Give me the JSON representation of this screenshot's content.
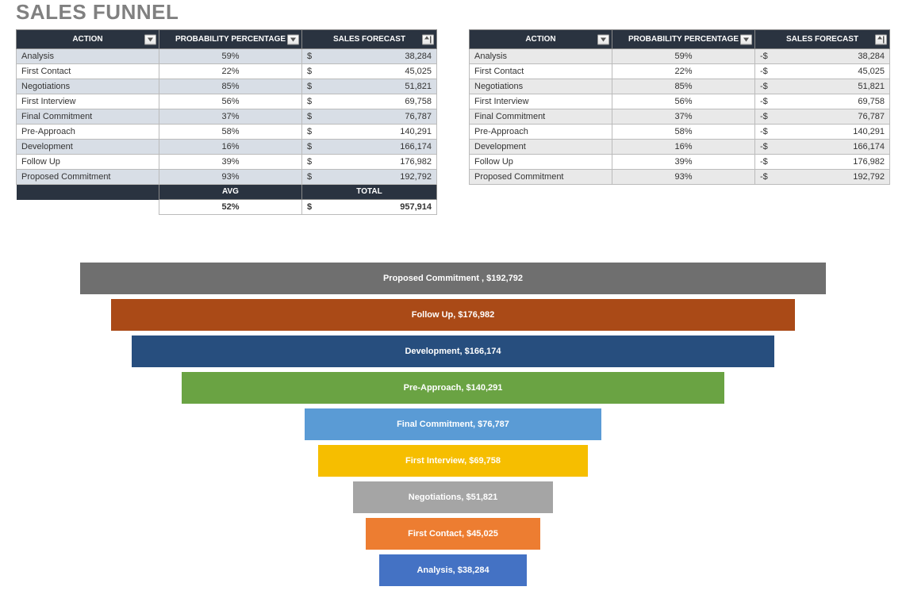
{
  "title": "SALES FUNNEL",
  "headers": {
    "action": "ACTION",
    "prob": "PROBABILITY PERCENTAGE",
    "forecast": "SALES FORECAST",
    "avg": "AVG",
    "total": "TOTAL"
  },
  "currency_left": "$",
  "currency_right": "-$",
  "rows": [
    {
      "action": "Analysis",
      "prob": "59%",
      "forecast": "38,284"
    },
    {
      "action": "First Contact",
      "prob": "22%",
      "forecast": "45,025"
    },
    {
      "action": "Negotiations",
      "prob": "85%",
      "forecast": "51,821"
    },
    {
      "action": "First Interview",
      "prob": "56%",
      "forecast": "69,758"
    },
    {
      "action": "Final Commitment",
      "prob": "37%",
      "forecast": "76,787"
    },
    {
      "action": "Pre-Approach",
      "prob": "58%",
      "forecast": "140,291"
    },
    {
      "action": "Development",
      "prob": "16%",
      "forecast": "166,174"
    },
    {
      "action": "Follow Up",
      "prob": "39%",
      "forecast": "176,982"
    },
    {
      "action": "Proposed Commitment",
      "prob": "93%",
      "forecast": "192,792"
    }
  ],
  "summary": {
    "avg": "52%",
    "total": "957,914"
  },
  "chart_data": {
    "type": "bar",
    "title": "",
    "orientation": "funnel",
    "series": [
      {
        "name": "Proposed Commitment",
        "value": 192792,
        "label": "Proposed Commitment ,  $192,792",
        "color": "#6f6f6f"
      },
      {
        "name": "Follow Up",
        "value": 176982,
        "label": "Follow Up,  $176,982",
        "color": "#aa4a17"
      },
      {
        "name": "Development",
        "value": 166174,
        "label": "Development,  $166,174",
        "color": "#274e7e"
      },
      {
        "name": "Pre-Approach",
        "value": 140291,
        "label": "Pre-Approach,  $140,291",
        "color": "#6aa343"
      },
      {
        "name": "Final Commitment",
        "value": 76787,
        "label": "Final Commitment,  $76,787",
        "color": "#5a9bd5"
      },
      {
        "name": "First Interview",
        "value": 69758,
        "label": "First Interview,  $69,758",
        "color": "#f6be00"
      },
      {
        "name": "Negotiations",
        "value": 51821,
        "label": "Negotiations,  $51,821",
        "color": "#a5a5a5"
      },
      {
        "name": "First Contact",
        "value": 45025,
        "label": "First Contact,  $45,025",
        "color": "#ed7d31"
      },
      {
        "name": "Analysis",
        "value": 38284,
        "label": "Analysis,  $38,284",
        "color": "#4472c4"
      }
    ],
    "max_value": 192792
  }
}
